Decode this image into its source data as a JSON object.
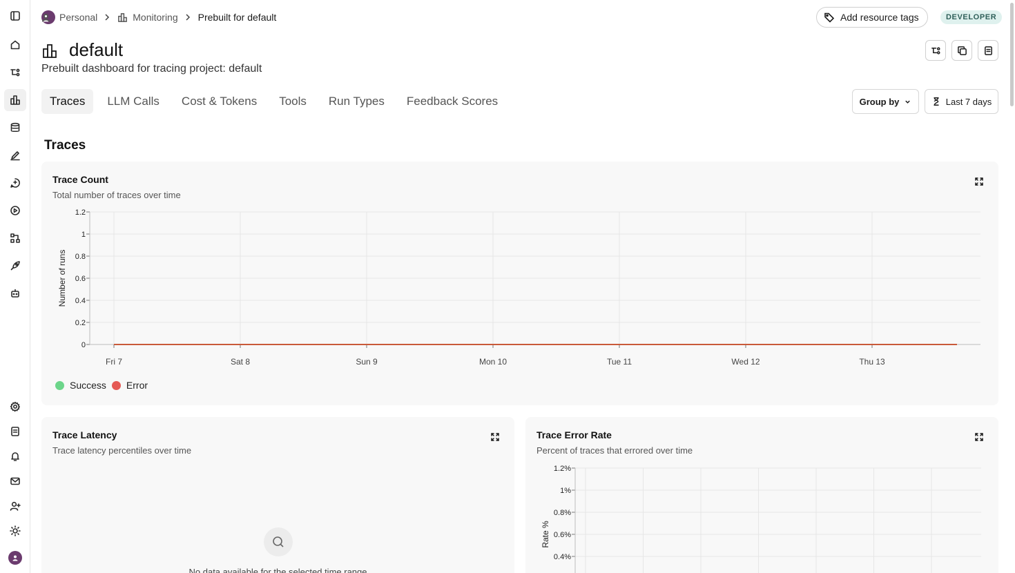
{
  "breadcrumb": {
    "org": "Personal",
    "section": "Monitoring",
    "current": "Prebuilt for default"
  },
  "header": {
    "add_tags_label": "Add resource tags",
    "badge": "DEVELOPER",
    "title": "default",
    "subtitle": "Prebuilt dashboard for tracing project: default"
  },
  "tabs": [
    {
      "label": "Traces",
      "active": true
    },
    {
      "label": "LLM Calls",
      "active": false
    },
    {
      "label": "Cost & Tokens",
      "active": false
    },
    {
      "label": "Tools",
      "active": false
    },
    {
      "label": "Run Types",
      "active": false
    },
    {
      "label": "Feedback Scores",
      "active": false
    }
  ],
  "controls": {
    "group_by": "Group by",
    "time_range": "Last 7 days"
  },
  "section": {
    "title": "Traces"
  },
  "cards": {
    "trace_count": {
      "title": "Trace Count",
      "subtitle": "Total number of traces over time"
    },
    "trace_latency": {
      "title": "Trace Latency",
      "subtitle": "Trace latency percentiles over time",
      "empty_text": "No data available for the selected time range"
    },
    "trace_error_rate": {
      "title": "Trace Error Rate",
      "subtitle": "Percent of traces that errored over time"
    }
  },
  "colors": {
    "success": "#6cd58a",
    "error": "#e55a55",
    "line": "#c95a3a",
    "badge_bg": "#dff1ee"
  },
  "chart_data": [
    {
      "type": "line",
      "title": "Trace Count",
      "xlabel": "",
      "ylabel": "Number of runs",
      "x": [
        "Fri 7",
        "Sat 8",
        "Sun 9",
        "Mon 10",
        "Tue 11",
        "Wed 12",
        "Thu 13"
      ],
      "yticks": [
        "0",
        "0.2",
        "0.4",
        "0.6",
        "0.8",
        "1",
        "1.2"
      ],
      "ylim": [
        0,
        1.2
      ],
      "grid": true,
      "legend": "bottom-left",
      "series": [
        {
          "name": "Success",
          "values": [
            0,
            0,
            0,
            0,
            0,
            0,
            0,
            0
          ]
        },
        {
          "name": "Error",
          "values": [
            0,
            0,
            0,
            0,
            0,
            0,
            0,
            0
          ]
        }
      ]
    },
    {
      "type": "line",
      "title": "Trace Error Rate",
      "xlabel": "",
      "ylabel": "Rate %",
      "yticks": [
        "0.4%",
        "0.6%",
        "0.8%",
        "1%",
        "1.2%"
      ],
      "ylim": [
        0,
        1.2
      ],
      "grid": true,
      "series": []
    }
  ]
}
